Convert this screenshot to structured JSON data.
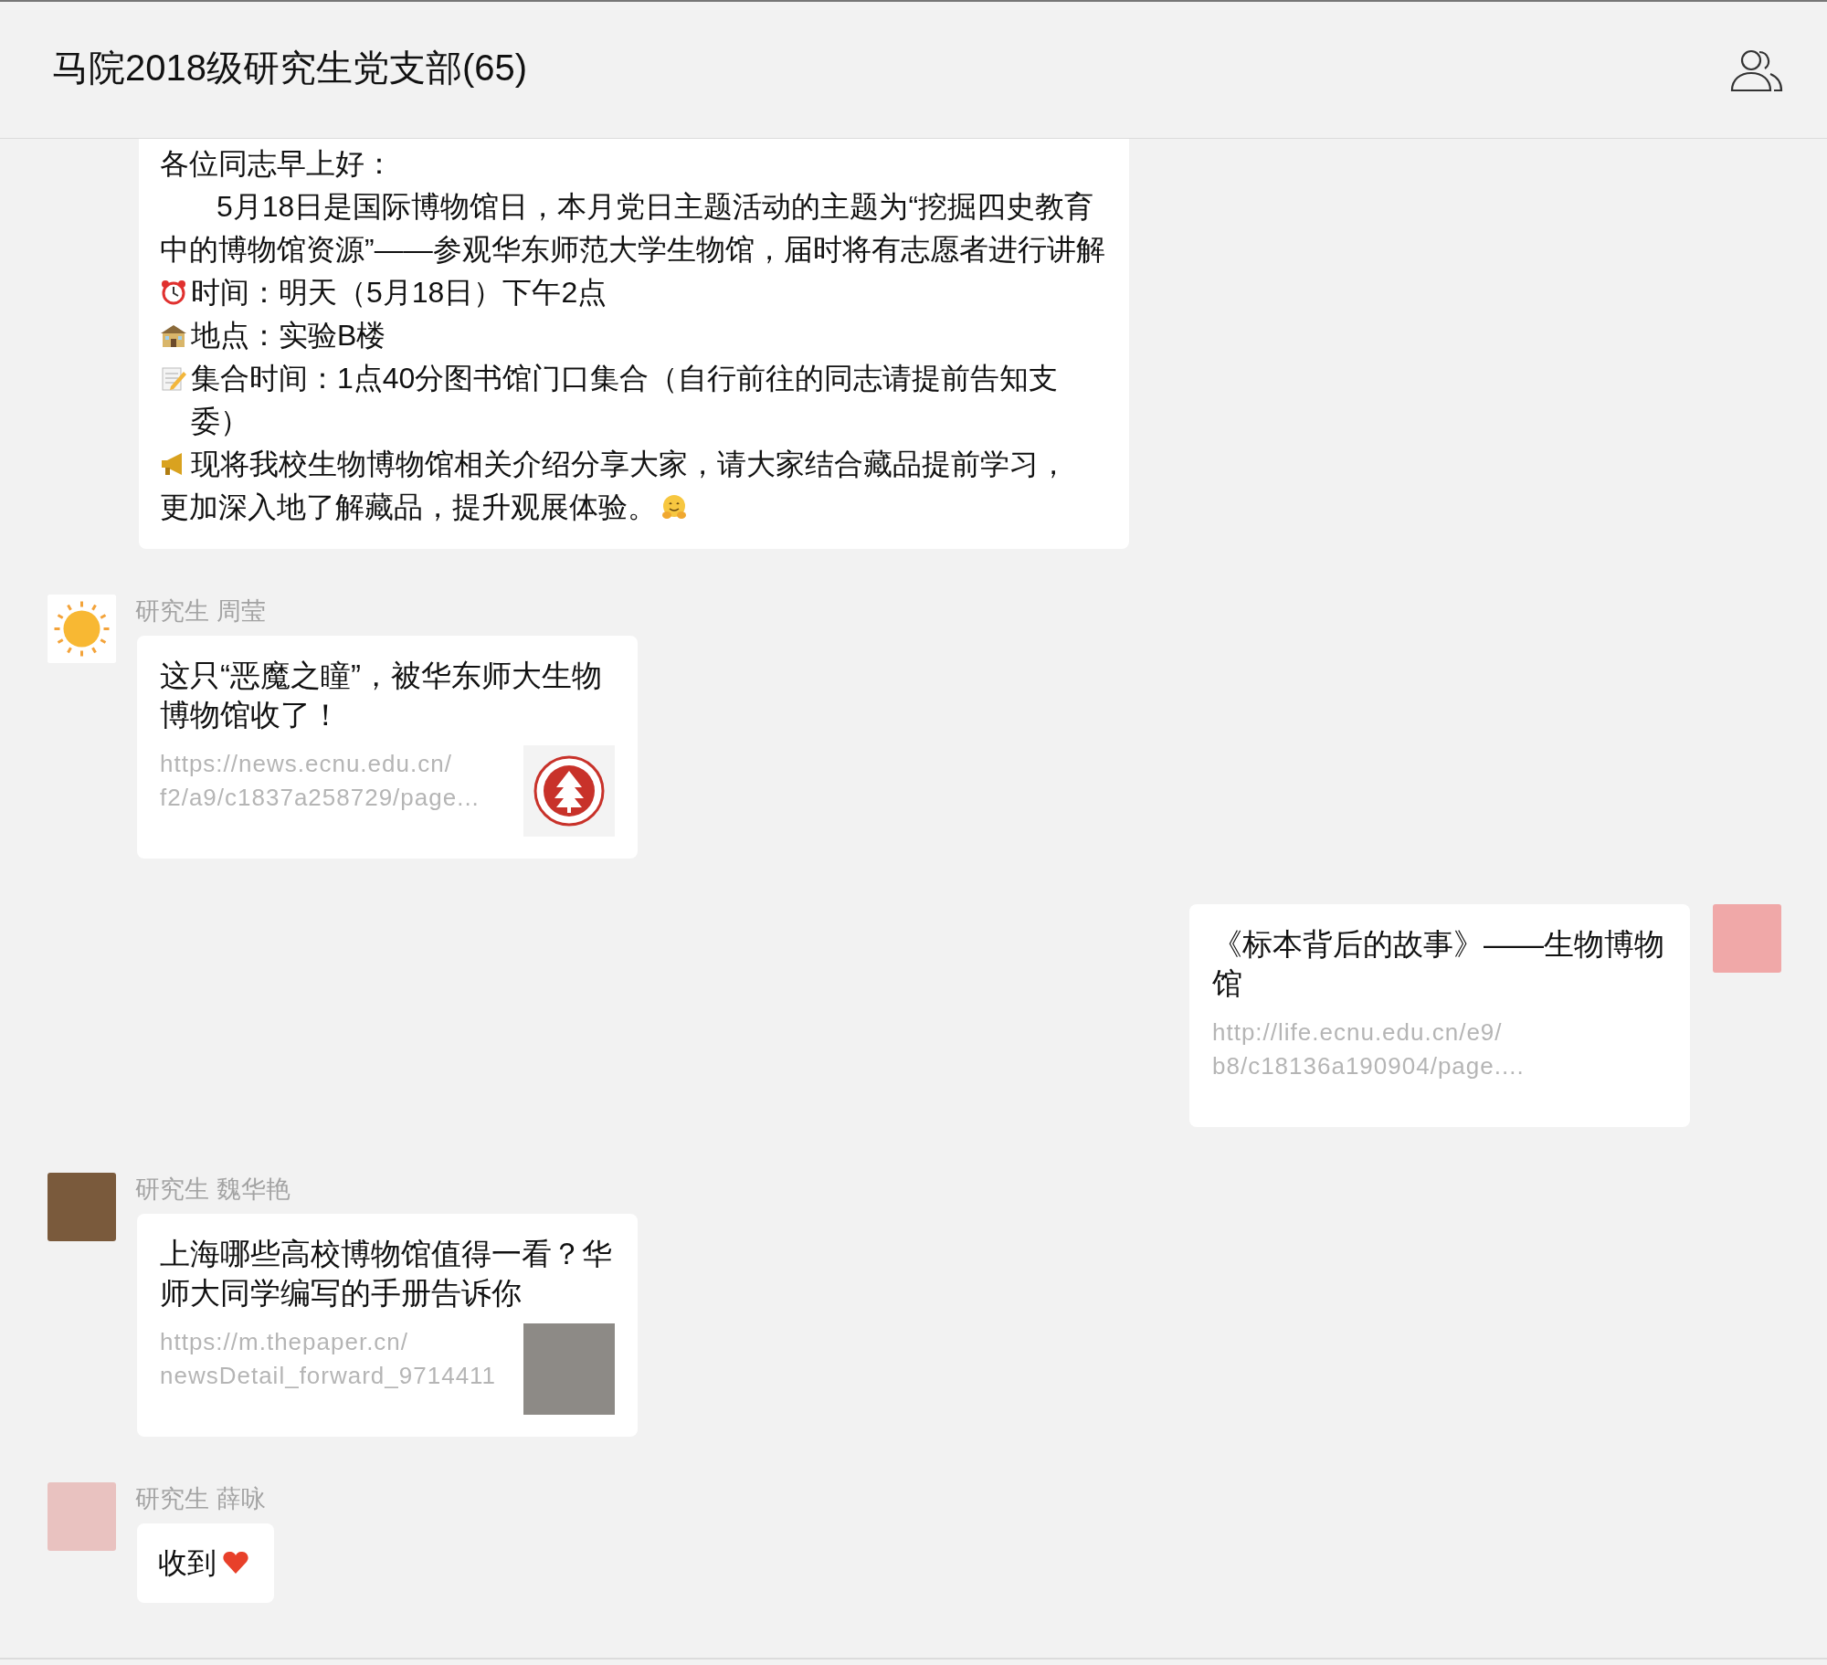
{
  "header": {
    "title": "马院2018级研究生党支部(65)"
  },
  "messages": [
    {
      "kind": "text",
      "outgoing": false,
      "lines": [
        {
          "kind": "plain",
          "text": "各位同志早上好："
        },
        {
          "kind": "indented",
          "text": "5月18日是国际博物馆日，本月党日主题活动的主题为“挖掘四史教育中的博物馆资源”——参观华东师范大学生物馆，届时将有志愿者进行讲解"
        },
        {
          "kind": "plain",
          "lead_emoji": {
            "kind": "alarm_clock"
          },
          "text": "时间：明天（5月18日）下午2点"
        },
        {
          "kind": "plain",
          "lead_emoji": {
            "kind": "school"
          },
          "text": "地点：实验B楼"
        },
        {
          "kind": "plain",
          "lead_emoji": {
            "kind": "memo"
          },
          "text": "集合时间：1点40分图书馆门口集合（自行前往的同志请提前告知支委）"
        },
        {
          "kind": "plain",
          "lead_emoji": {
            "kind": "megaphone"
          },
          "text": "现将我校生物博物馆相关介绍分享大家，请大家结合藏品提前学习，"
        },
        {
          "kind": "plain",
          "text": "更加深入地了解藏品，提升观展体验。",
          "trail_emoji": {
            "kind": "hug"
          }
        }
      ]
    },
    {
      "kind": "link",
      "outgoing": false,
      "sender": "研究生 周莹",
      "avatar": {
        "kind": "sun"
      },
      "title": "这只“恶魔之瞳”，被华东师大生物博物馆收了！",
      "url_lines": [
        "https://news.ecnu.edu.cn/",
        "f2/a9/c1837a258729/page..."
      ],
      "thumbnail": {
        "kind": "seal"
      }
    },
    {
      "kind": "link",
      "outgoing": true,
      "avatar": {
        "kind": "cartoon"
      },
      "title": "《标本背后的故事》——生物博物馆",
      "url_lines": [
        "http://life.ecnu.edu.cn/e9/",
        "b8/c18136a190904/page...."
      ]
    },
    {
      "kind": "link",
      "outgoing": false,
      "sender": "研究生 魏华艳",
      "avatar": {
        "kind": "photo"
      },
      "title": "上海哪些高校博物馆值得一看？华师大同学编写的手册告诉你",
      "url_lines": [
        "https://m.thepaper.cn/",
        "newsDetail_forward_9714411"
      ],
      "thumbnail": {
        "kind": "photo"
      }
    },
    {
      "kind": "text",
      "outgoing": false,
      "sender": "研究生 薛咏",
      "avatar": {
        "kind": "pigs"
      },
      "lines": [
        {
          "kind": "plain",
          "text": "收到",
          "trail_emoji": {
            "kind": "heart"
          }
        }
      ]
    }
  ]
}
